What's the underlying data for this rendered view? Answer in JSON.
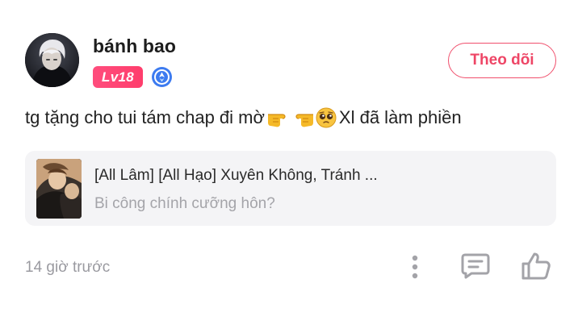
{
  "user": {
    "name": "bánh bao",
    "level": "Lv18",
    "follow_label": "Theo dõi"
  },
  "post": {
    "text_before": "tg tặng cho tui tám chap đi mờ",
    "text_after": "Xl đã làm phiền",
    "emojis": [
      "pointing-right-icon",
      "pointing-left-icon",
      "pleading-face-icon"
    ]
  },
  "comic": {
    "title": "[All Lâm] [All Hạo] Xuyên Không, Tránh ...",
    "subtitle": "Bi công chính cưỡng hôn?"
  },
  "footer": {
    "timestamp": "14 giờ trước"
  },
  "colors": {
    "accent": "#ee4666",
    "badge": "#ff4d7d",
    "verify": "#3d7bf0",
    "muted": "#9a9aa0",
    "card_bg": "#f4f4f6"
  }
}
